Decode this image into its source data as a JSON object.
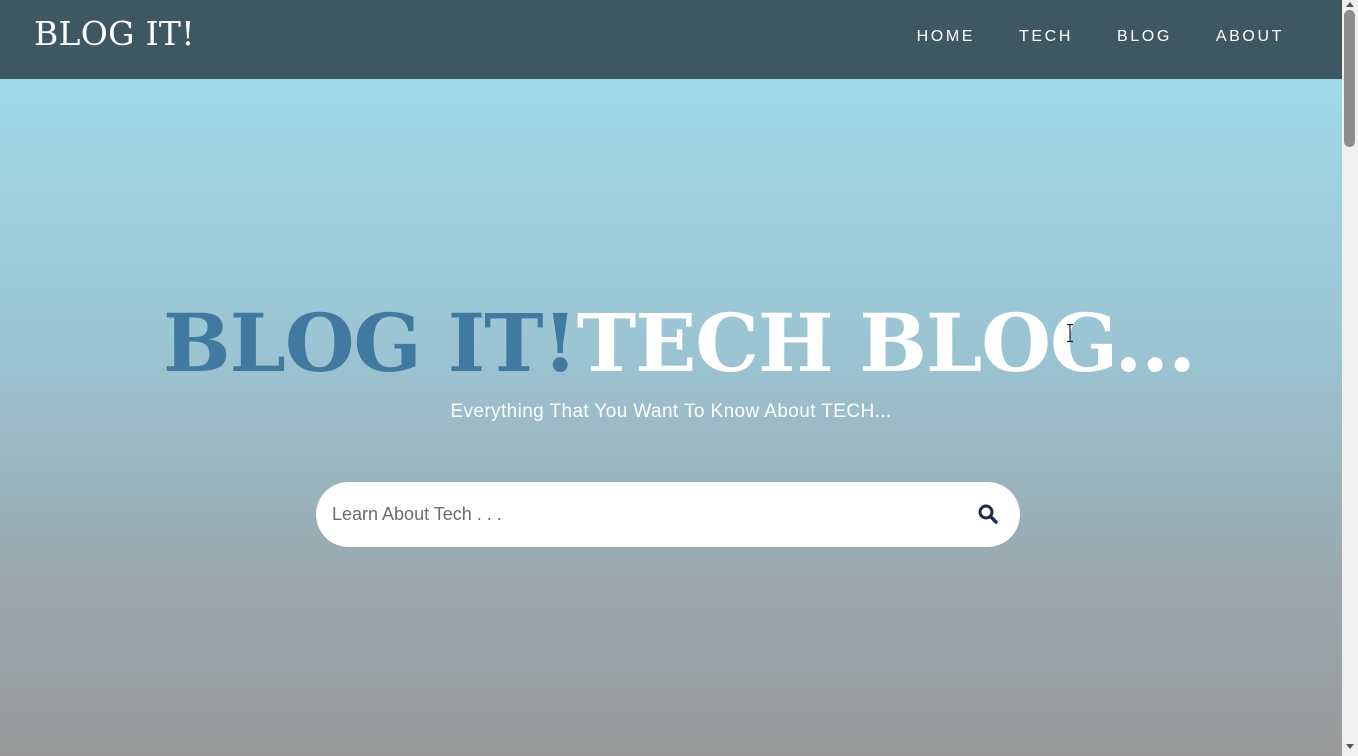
{
  "navbar": {
    "brand": "BLOG IT!",
    "links": [
      "HOME",
      "TECH",
      "BLOG",
      "ABOUT"
    ]
  },
  "hero": {
    "title_part1": "BLOG IT!",
    "title_part2": "TECH BLOG...",
    "subtitle": "Everything That You Want To Know About TECH...",
    "search": {
      "placeholder": "Learn About Tech . . .",
      "button_icon": "search-icon"
    }
  },
  "colors": {
    "navbar_bg": "#3f5762",
    "title_accent": "#4279a1",
    "search_icon": "#1c2b4a",
    "gradient_top": "#9fd9e9",
    "gradient_bottom": "#999999"
  }
}
